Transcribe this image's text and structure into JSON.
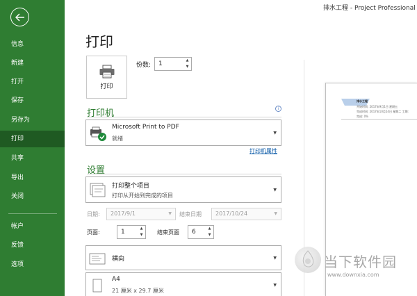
{
  "window": {
    "title": "排水工程  -  Project Professional"
  },
  "sidebar": {
    "items": [
      {
        "label": "信息"
      },
      {
        "label": "新建"
      },
      {
        "label": "打开"
      },
      {
        "label": "保存"
      },
      {
        "label": "另存为"
      },
      {
        "label": "打印",
        "active": true
      },
      {
        "label": "共享"
      },
      {
        "label": "导出"
      },
      {
        "label": "关闭"
      },
      {
        "label": "帐户"
      },
      {
        "label": "反馈"
      },
      {
        "label": "选项"
      }
    ]
  },
  "print": {
    "title": "打印",
    "button_label": "打印",
    "copies_label": "份数:",
    "copies_value": "1"
  },
  "printer": {
    "section_title": "打印机",
    "name": "Microsoft Print to PDF",
    "status": "就绪",
    "properties_link": "打印机属性"
  },
  "settings": {
    "section_title": "设置",
    "scope_title": "打印整个项目",
    "scope_desc": "打印从开始到完成的项目",
    "date_label": "日期:",
    "date_value": "2017/9/1",
    "end_date_label": "结束日期",
    "end_date_value": "2017/10/24",
    "page_label": "页面:",
    "page_value": "1",
    "end_page_label": "结束页面",
    "end_page_value": "6",
    "orientation": "横向",
    "paper_name": "A4",
    "paper_size": "21 厘米 x 29.7 厘米"
  },
  "preview": {
    "header_text": "排水工程",
    "line1": "开始时间: 2017年9月1日 星期五",
    "line2": "完成时间: 2017年10月24日 星期二  工期:",
    "line3": "完成: 0%"
  },
  "watermark": {
    "text": "当下软件园",
    "url": "www.downxia.com"
  },
  "colors": {
    "sidebar_bg": "#2f7d32",
    "sidebar_active": "#1f5a22",
    "accent_green": "#2f7d32",
    "link_blue": "#0b5aa8"
  }
}
